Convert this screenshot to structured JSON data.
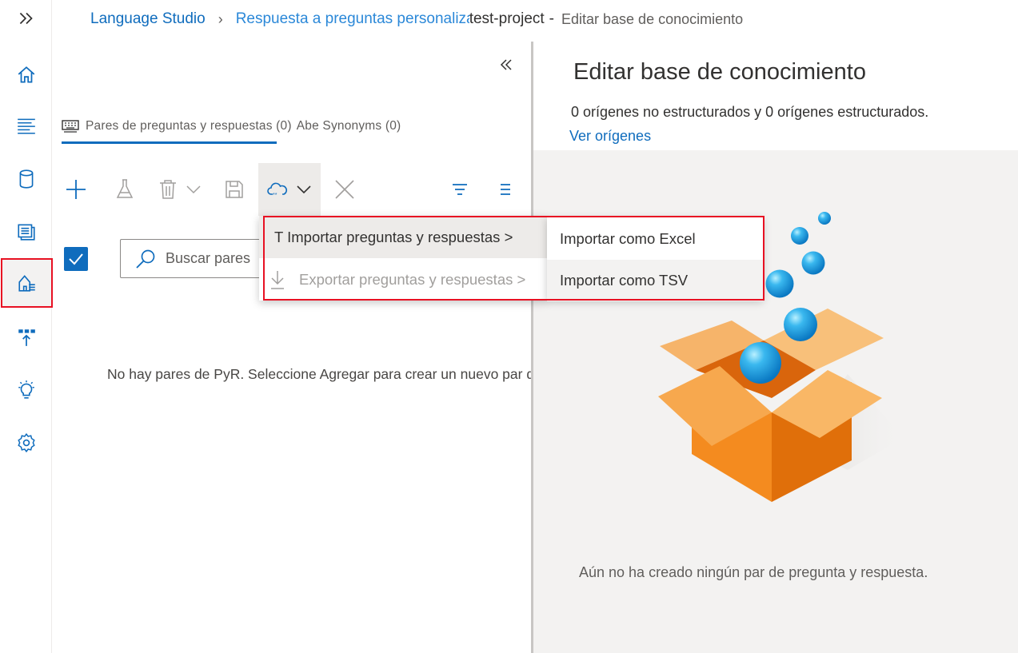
{
  "rail": {
    "items": [
      {
        "icon": "expand-icon"
      },
      {
        "icon": "home-icon"
      },
      {
        "icon": "text-lines-icon"
      },
      {
        "icon": "database-icon"
      },
      {
        "icon": "knowledge-base-icon"
      },
      {
        "icon": "question-answer-icon",
        "active": true
      },
      {
        "icon": "deploy-icon"
      },
      {
        "icon": "lightbulb-icon"
      },
      {
        "icon": "settings-icon"
      }
    ],
    "active_border_color": "#e81123"
  },
  "breadcrumb": {
    "root": "Language Studio",
    "section": "Respuesta a preguntas personalizada",
    "project": "test-project",
    "dash": "-",
    "current": "Editar base de conocimiento"
  },
  "left_pane": {
    "tabs": {
      "qna_label": "Pares de preguntas y respuestas (0)",
      "synonyms_label": "Abe Synonyms (0)"
    },
    "toolbar": [
      "add-icon",
      "test-icon",
      "delete-icon",
      "save-icon",
      "import-cloud-icon",
      "close-icon",
      "filter-icon",
      "list-icon"
    ],
    "search": {
      "placeholder": "Buscar pares"
    },
    "empty_message": "No hay pares de PyR. Seleccione Agregar para crear un nuevo par de PyR"
  },
  "menu": {
    "import_label": "T Importar preguntas y respuestas >",
    "export_label": "Exportar preguntas y respuestas >",
    "submenu": {
      "excel": "Importar como Excel",
      "tsv": "Importar como TSV"
    }
  },
  "right_pane": {
    "title": "Editar base de conocimiento",
    "sources_text": "0 orígenes no estructurados y 0 orígenes estructurados.",
    "view_sources": "Ver orígenes",
    "empty_message": "Aún no ha creado ningún par de pregunta y respuesta."
  },
  "colors": {
    "accent": "#0f6cbd",
    "highlight": "#e81123",
    "box_orange": "#f28c28"
  }
}
